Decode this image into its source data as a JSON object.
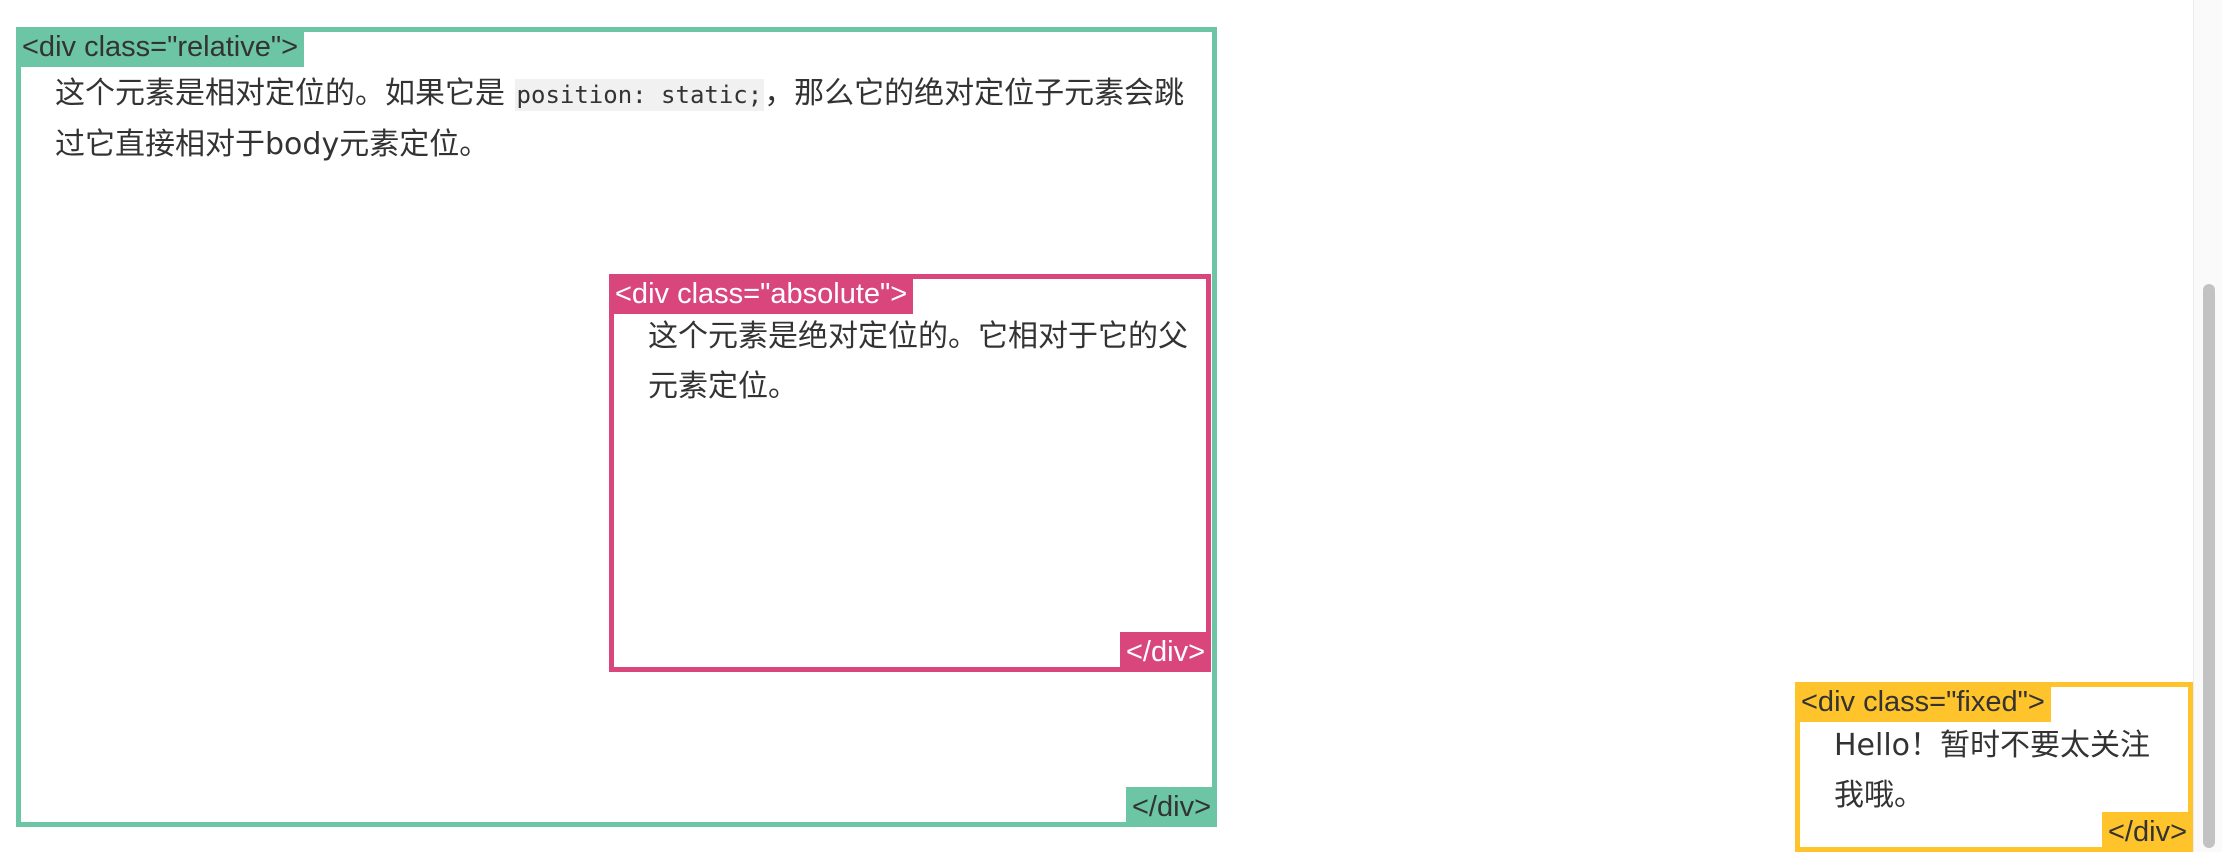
{
  "relative_box": {
    "open_tag": "<div class=\"relative\">",
    "close_tag": "</div>",
    "text_before_code": "这个元素是相对定位的。如果它是 ",
    "code": "position: static;",
    "text_after_code": "，那么它的绝对定位子元素会跳过它直接相对于body元素定位。"
  },
  "absolute_box": {
    "open_tag": "<div class=\"absolute\">",
    "close_tag": "</div>",
    "text": "这个元素是绝对定位的。它相对于它的父元素定位。"
  },
  "fixed_box": {
    "open_tag": "<div class=\"fixed\">",
    "close_tag": "</div>",
    "text": "Hello！暂时不要太关注我哦。"
  },
  "colors": {
    "relative": "#6cc6a6",
    "absolute": "#d9467c",
    "fixed": "#ffc32b",
    "text": "#333333"
  }
}
